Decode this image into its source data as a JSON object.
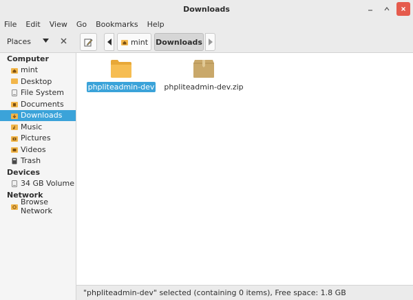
{
  "window": {
    "title": "Downloads"
  },
  "menubar": {
    "items": [
      "File",
      "Edit",
      "View",
      "Go",
      "Bookmarks",
      "Help"
    ]
  },
  "toolbar": {
    "places_label": "Places",
    "breadcrumbs": [
      "mint",
      "Downloads"
    ]
  },
  "sidebar": {
    "sections": [
      {
        "title": "Computer",
        "items": [
          {
            "label": "mint",
            "icon": "home-icon"
          },
          {
            "label": "Desktop",
            "icon": "desktop-icon"
          },
          {
            "label": "File System",
            "icon": "drive-icon"
          },
          {
            "label": "Documents",
            "icon": "documents-icon"
          },
          {
            "label": "Downloads",
            "icon": "downloads-icon",
            "active": true
          },
          {
            "label": "Music",
            "icon": "music-icon"
          },
          {
            "label": "Pictures",
            "icon": "pictures-icon"
          },
          {
            "label": "Videos",
            "icon": "videos-icon"
          },
          {
            "label": "Trash",
            "icon": "trash-icon"
          }
        ]
      },
      {
        "title": "Devices",
        "items": [
          {
            "label": "34 GB Volume",
            "icon": "drive-icon"
          }
        ]
      },
      {
        "title": "Network",
        "items": [
          {
            "label": "Browse Network",
            "icon": "network-icon"
          }
        ]
      }
    ]
  },
  "files": [
    {
      "name": "phpliteadmin-dev",
      "type": "folder-icon",
      "selected": true
    },
    {
      "name": "phpliteadmin-dev.zip",
      "type": "archive-icon",
      "selected": false
    }
  ],
  "status": {
    "text": "\"phpliteadmin-dev\" selected (containing 0 items), Free space: 1.8 GB"
  },
  "colors": {
    "accent": "#3ba3d9",
    "folder": "#f2b64a",
    "archive": "#c9a86a",
    "close": "#e55b4d"
  }
}
